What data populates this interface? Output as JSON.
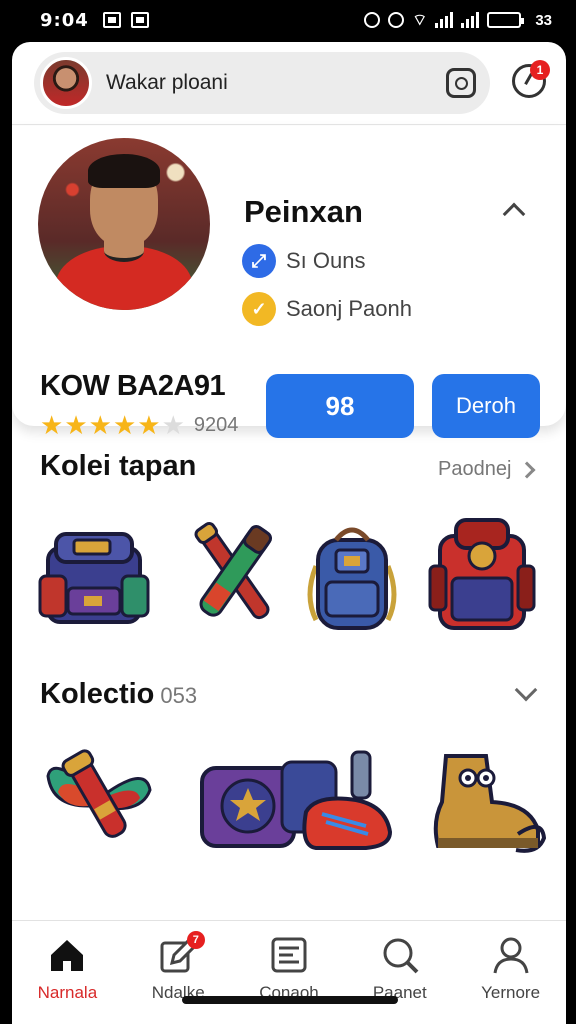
{
  "status_bar": {
    "time": "9:04",
    "battery_label": "33",
    "battery_level": 0.85
  },
  "search": {
    "text": "Wakar ploani"
  },
  "notifications": {
    "badge": "1"
  },
  "profile": {
    "name": "Peinxan",
    "info_1": "Sı Ouns",
    "info_2": "Saonj Paonh",
    "title": "KOW BA2A91",
    "rating_stars": 5,
    "rating_max": 6,
    "rating_count": "9204",
    "primary_button": "98",
    "secondary_button": "Deroh"
  },
  "sections": [
    {
      "title": "Kolei tapan",
      "link": "Paodnej"
    },
    {
      "title": "Kolectio",
      "count": "053"
    }
  ],
  "bottom_nav": [
    {
      "label": "Narnala",
      "icon": "home-icon",
      "active": true
    },
    {
      "label": "Ndalke",
      "icon": "edit-icon",
      "badge": "7"
    },
    {
      "label": "Conaoh",
      "icon": "list-icon"
    },
    {
      "label": "Paanet",
      "icon": "search-icon"
    },
    {
      "label": "Yernore",
      "icon": "profile-icon"
    }
  ],
  "colors": {
    "accent": "#2674e8",
    "active_tab": "#d82a2a",
    "star": "#f7b519"
  }
}
